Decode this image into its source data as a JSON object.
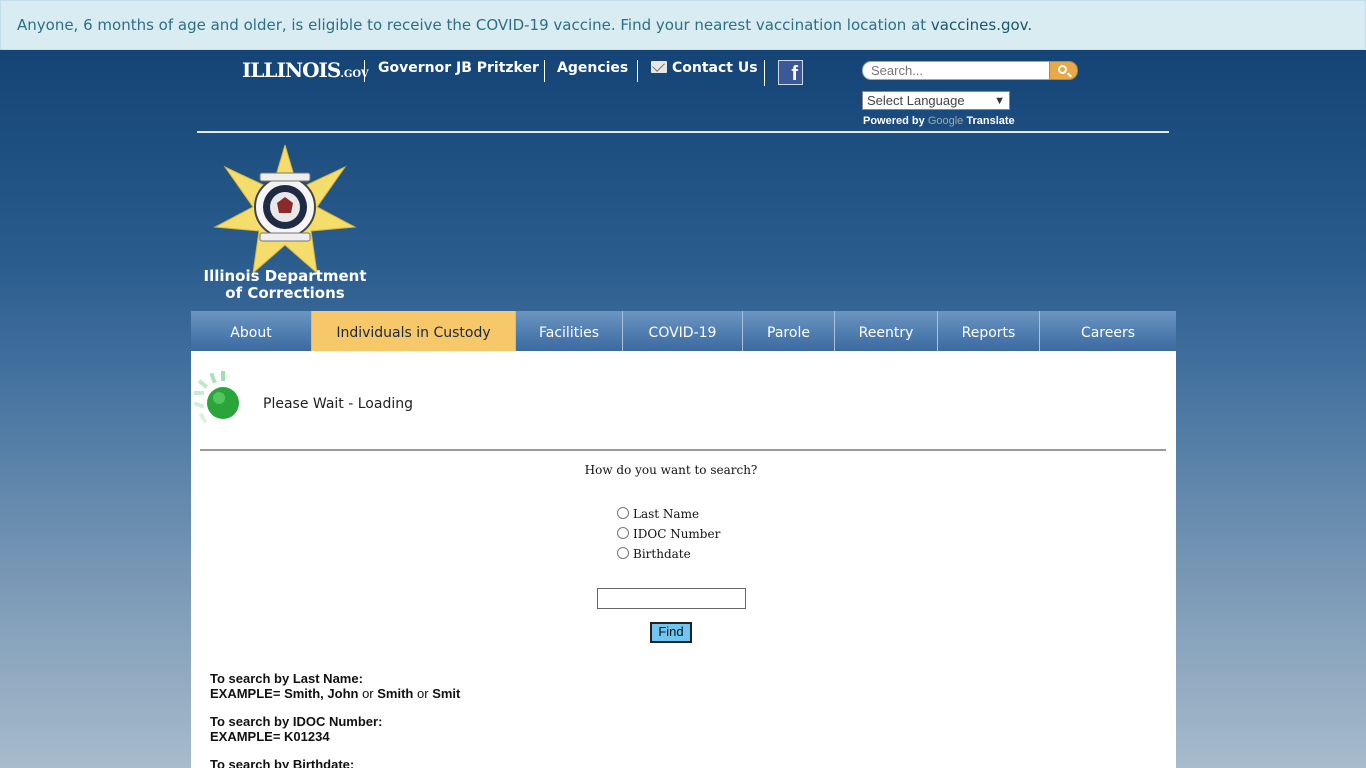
{
  "alert": {
    "text": "Anyone, 6 months of age and older, is eligible to receive the COVID-19 vaccine. Find your nearest vaccination location at",
    "link": "vaccines.gov."
  },
  "topbar": {
    "site_logo_main": "ILLINOIS",
    "site_logo_suffix": ".GOV",
    "governor_label": "Governor JB Pritzker",
    "agencies_label": "Agencies",
    "contact_label": "Contact Us",
    "facebook_icon": "facebook-icon",
    "search_placeholder": "Search...",
    "language_select": "Select Language",
    "powered_by": "Powered by",
    "google": "Google",
    "translate": "Translate"
  },
  "agency": {
    "title_line1": "Illinois Department",
    "title_line2": "of Corrections"
  },
  "nav": [
    {
      "label": "About",
      "active": false
    },
    {
      "label": "Individuals in Custody",
      "active": true
    },
    {
      "label": "Facilities",
      "active": false
    },
    {
      "label": "COVID-19",
      "active": false
    },
    {
      "label": "Parole",
      "active": false
    },
    {
      "label": "Reentry",
      "active": false
    },
    {
      "label": "Reports",
      "active": false
    },
    {
      "label": "Careers",
      "active": false
    }
  ],
  "content": {
    "loading_text": "Please Wait - Loading",
    "question": "How do you want to search?",
    "options": [
      "Last Name",
      "IDOC Number",
      "Birthdate"
    ],
    "search_value": "",
    "find_label": "Find",
    "help": {
      "last_name_title": "To search by Last Name:",
      "last_name_prefix": "EXAMPLE=",
      "last_name_ex1": "Smith, John",
      "or1": "or",
      "last_name_ex2": "Smith",
      "or2": "or",
      "last_name_ex3": "Smit",
      "idoc_title": "To search by IDOC Number:",
      "idoc_example": "EXAMPLE= K01234",
      "birth_title": "To search by Birthdate:"
    }
  }
}
